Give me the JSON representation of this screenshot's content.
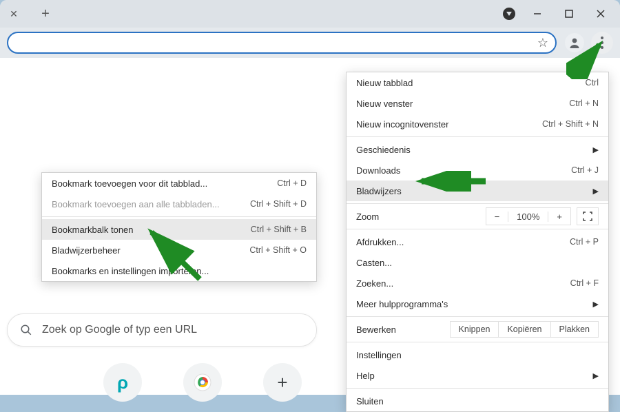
{
  "search_placeholder": "Zoek op Google of typ een URL",
  "main_menu": {
    "new_tab": {
      "label": "Nieuw tabblad",
      "shortcut": "Ctrl"
    },
    "new_window": {
      "label": "Nieuw venster",
      "shortcut": "Ctrl + N"
    },
    "incognito": {
      "label": "Nieuw incognitovenster",
      "shortcut": "Ctrl + Shift + N"
    },
    "history": {
      "label": "Geschiedenis"
    },
    "downloads": {
      "label": "Downloads",
      "shortcut": "Ctrl + J"
    },
    "bookmarks": {
      "label": "Bladwijzers"
    },
    "zoom": {
      "label": "Zoom",
      "value": "100%",
      "minus": "−",
      "plus": "+"
    },
    "print": {
      "label": "Afdrukken...",
      "shortcut": "Ctrl + P"
    },
    "cast": {
      "label": "Casten..."
    },
    "find": {
      "label": "Zoeken...",
      "shortcut": "Ctrl + F"
    },
    "moretools": {
      "label": "Meer hulpprogramma's"
    },
    "edit": {
      "label": "Bewerken",
      "cut": "Knippen",
      "copy": "Kopiëren",
      "paste": "Plakken"
    },
    "settings": {
      "label": "Instellingen"
    },
    "help": {
      "label": "Help"
    },
    "exit": {
      "label": "Sluiten"
    }
  },
  "sub_menu": {
    "add_tab": {
      "label": "Bookmark toevoegen voor dit tabblad...",
      "shortcut": "Ctrl + D"
    },
    "add_all": {
      "label": "Bookmark toevoegen aan alle tabbladen...",
      "shortcut": "Ctrl + Shift + D"
    },
    "show_bar": {
      "label": "Bookmarkbalk tonen",
      "shortcut": "Ctrl + Shift + B"
    },
    "manager": {
      "label": "Bladwijzerbeheer",
      "shortcut": "Ctrl + Shift + O"
    },
    "import": {
      "label": "Bookmarks en instellingen importeren..."
    }
  }
}
